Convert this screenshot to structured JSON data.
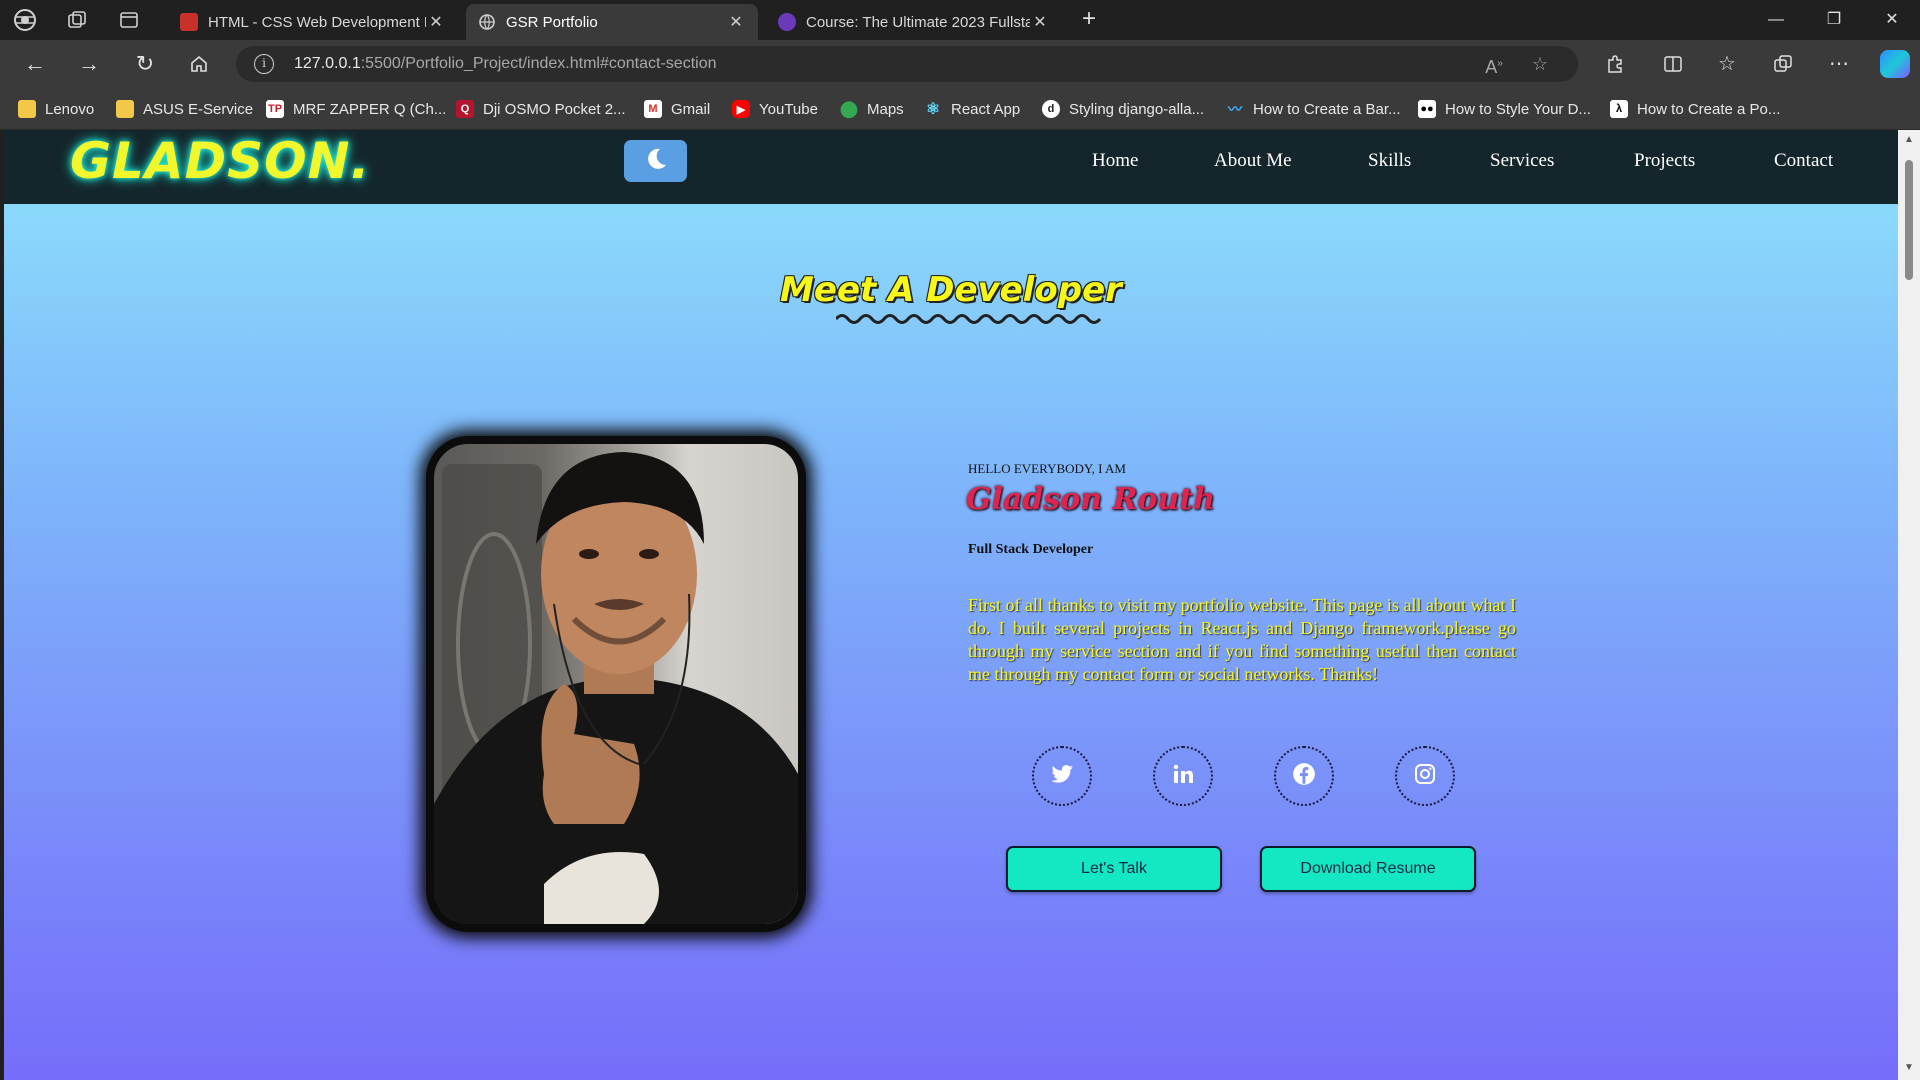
{
  "browser": {
    "tabs": [
      {
        "title": "HTML - CSS Web Development P",
        "favicon": "pdf-icon",
        "active": false
      },
      {
        "title": "GSR Portfolio",
        "favicon": "globe-icon",
        "active": true
      },
      {
        "title": "Course: The Ultimate 2023 Fullsta",
        "favicon": "course-icon",
        "active": false
      }
    ],
    "url_host": "127.0.0.1",
    "url_rest": ":5500/Portfolio_Project/index.html#contact-section",
    "bookmarks": [
      {
        "label": "Lenovo",
        "icon": "folder-icon"
      },
      {
        "label": "ASUS E-Service",
        "icon": "folder-icon"
      },
      {
        "label": "MRF ZAPPER Q (Ch...",
        "icon": "tp-icon"
      },
      {
        "label": "Dji OSMO Pocket 2...",
        "icon": "q-icon"
      },
      {
        "label": "Gmail",
        "icon": "gmail-icon"
      },
      {
        "label": "YouTube",
        "icon": "youtube-icon"
      },
      {
        "label": "Maps",
        "icon": "maps-icon"
      },
      {
        "label": "React App",
        "icon": "react-icon"
      },
      {
        "label": "Styling django-alla...",
        "icon": "django-icon"
      },
      {
        "label": "How to Create a Bar...",
        "icon": "wave-icon"
      },
      {
        "label": "How to Style Your D...",
        "icon": "medium-icon"
      },
      {
        "label": "How to Create a Po...",
        "icon": "lambda-icon"
      }
    ],
    "colors": {
      "chrome_dark": "#202020",
      "chrome": "#3a3a3a"
    }
  },
  "site": {
    "logo": "GLADSON.",
    "nav": [
      "Home",
      "About Me",
      "Skills",
      "Services",
      "Projects",
      "Contact"
    ],
    "hero_title": "Meet A Developer",
    "greeting": "HELLO EVERYBODY, I AM",
    "name": "Gladson Routh",
    "role": "Full Stack Developer",
    "intro": "First of all thanks to visit my portfolio website. This page is all about what I do. I built several projects in React.js and Django framework.please go through my service section and if you find something useful then contact me through my contact form or social networks. Thanks!",
    "socials": [
      "twitter-icon",
      "linkedin-icon",
      "facebook-icon",
      "instagram-icon"
    ],
    "buttons": {
      "talk": "Let's Talk",
      "resume": "Download Resume"
    },
    "colors": {
      "accent_yellow": "#f7f71a",
      "name_red": "#e0244e",
      "button": "#14e8c3",
      "nav_bg": "#14262b"
    }
  }
}
